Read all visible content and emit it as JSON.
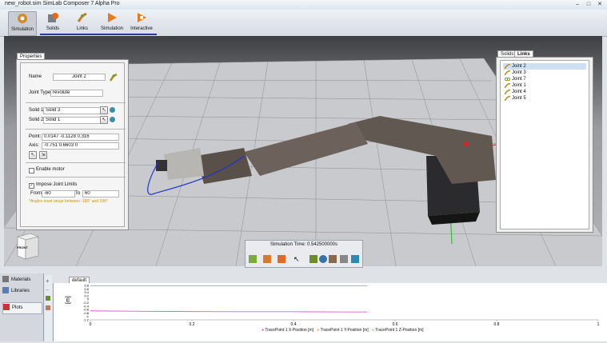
{
  "window": {
    "title": "new_robot.sim SimLab Composer 7 Alpha Pro",
    "controls": [
      "–",
      "□",
      "✕"
    ]
  },
  "ribbon": {
    "buttons": [
      {
        "label": "Simulation"
      },
      {
        "label": "Solids"
      },
      {
        "label": "Links"
      },
      {
        "label": "Simulation"
      },
      {
        "label": "Interactive"
      }
    ]
  },
  "properties": {
    "tab": "Properties",
    "name_label": "Name",
    "name_value": "Joint 2",
    "joint_type_label": "Joint Type",
    "joint_type_value": "revolute",
    "solid1_label": "Solid 1",
    "solid1_value": "Solid 3",
    "solid2_label": "Solid 2",
    "solid2_value": "Solid 1",
    "point_label": "Point:",
    "point_value": "0.0147 -0.1128 0.316",
    "axis_label": "Axis:",
    "axis_value": "-0.751 0.6603 0",
    "enable_motor_label": "Enable motor",
    "enable_motor_checked": false,
    "impose_limits_label": "Impose Joint Limits",
    "impose_limits_checked": true,
    "from_label": "From",
    "from_value": "-60",
    "to_label": "To",
    "to_value": "60",
    "note": "*Angles must range between -180° and 180°"
  },
  "tree": {
    "tabs": [
      "Solids",
      "Links"
    ],
    "active_tab": "Links",
    "items": [
      "Joint 2",
      "Joint 3",
      "Joint 7",
      "Joint 1",
      "Joint 4",
      "Joint 5"
    ],
    "selected": "Joint 2"
  },
  "viewcube": {
    "front": "FRONT",
    "left": "LEFT",
    "top": "TOP"
  },
  "simbar": {
    "time_label": "Simulation Time: 0.542500000s"
  },
  "bottom": {
    "left_items": [
      "Materials",
      "Libraries",
      "Plots"
    ],
    "plot_tab": "default",
    "y_label": "[m]",
    "y_ticks": [
      "0.8",
      "0.6",
      "0.4",
      "0.2",
      "0",
      "-0.2",
      "-0.4",
      "-0.6",
      "-0.8",
      "-1",
      "-1.2"
    ],
    "x_ticks": [
      "0",
      "0.2",
      "0.4",
      "0.6",
      "0.8",
      "1"
    ],
    "legend": [
      {
        "name": "TracePoint 1 X-Position [m]",
        "color": "#e040c8"
      },
      {
        "name": "TracePoint 1 Y-Position [m]",
        "color": "#f0a040"
      },
      {
        "name": "TracePoint 1 Z-Position [m]",
        "color": "#7fd08a"
      }
    ]
  },
  "chart_data": {
    "type": "line",
    "ylabel": "[m]",
    "xlim": [
      0,
      1
    ],
    "ylim": [
      -1.2,
      0.8
    ],
    "series": [
      {
        "name": "TracePoint 1 X-Position [m]",
        "x": [
          0,
          0.1,
          0.2,
          0.3,
          0.4,
          0.5,
          0.545
        ],
        "y": [
          -0.68,
          -0.7,
          -0.72,
          -0.73,
          -0.73,
          -0.74,
          -0.74
        ],
        "color": "#e040c8"
      },
      {
        "name": "TracePoint 1 Y-Position [m]",
        "x": [
          0,
          0.2,
          0.4,
          0.545
        ],
        "y": [
          0.78,
          0.78,
          0.78,
          0.78
        ],
        "color": "#f0a040"
      },
      {
        "name": "TracePoint 1 Z-Position [m]",
        "x": [
          0,
          0.2,
          0.4,
          0.545
        ],
        "y": [
          0.79,
          0.79,
          0.79,
          0.79
        ],
        "color": "#7fd08a"
      }
    ]
  }
}
